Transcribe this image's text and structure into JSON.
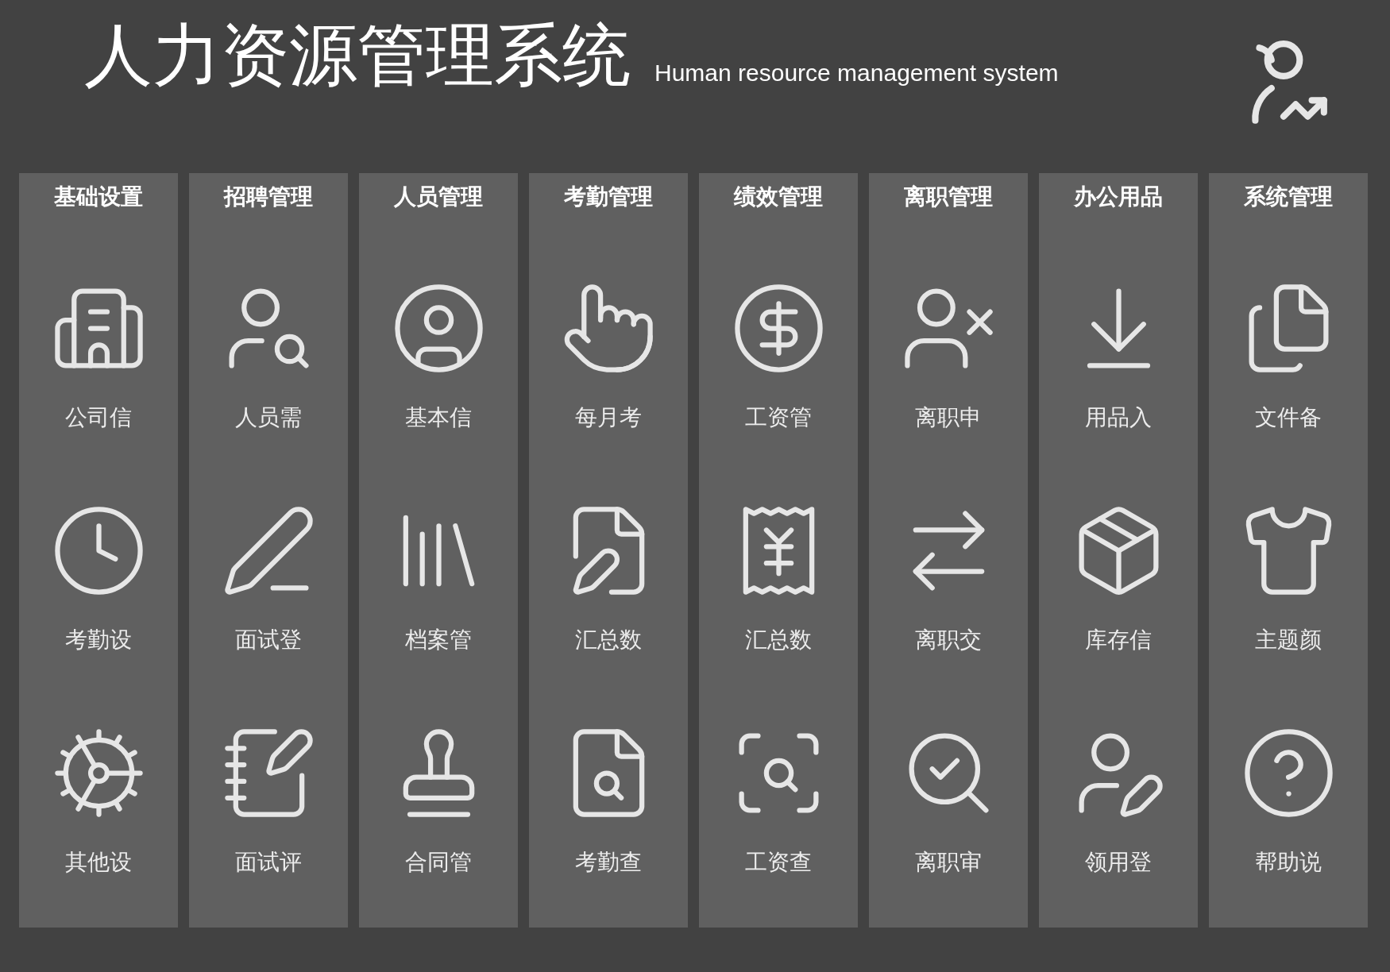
{
  "header": {
    "title": "人力资源管理系统",
    "subtitle": "Human resource management system"
  },
  "columns": [
    {
      "heading": "基础设置",
      "items": [
        {
          "label": "公司信"
        },
        {
          "label": "考勤设"
        },
        {
          "label": "其他设"
        }
      ]
    },
    {
      "heading": "招聘管理",
      "items": [
        {
          "label": "人员需"
        },
        {
          "label": "面试登"
        },
        {
          "label": "面试评"
        }
      ]
    },
    {
      "heading": "人员管理",
      "items": [
        {
          "label": "基本信"
        },
        {
          "label": "档案管"
        },
        {
          "label": "合同管"
        }
      ]
    },
    {
      "heading": "考勤管理",
      "items": [
        {
          "label": "每月考"
        },
        {
          "label": "汇总数"
        },
        {
          "label": "考勤查"
        }
      ]
    },
    {
      "heading": "绩效管理",
      "items": [
        {
          "label": "工资管"
        },
        {
          "label": "汇总数"
        },
        {
          "label": "工资查"
        }
      ]
    },
    {
      "heading": "离职管理",
      "items": [
        {
          "label": "离职申"
        },
        {
          "label": "离职交"
        },
        {
          "label": "离职审"
        }
      ]
    },
    {
      "heading": "办公用品",
      "items": [
        {
          "label": "用品入"
        },
        {
          "label": "库存信"
        },
        {
          "label": "领用登"
        }
      ]
    },
    {
      "heading": "系统管理",
      "items": [
        {
          "label": "文件备"
        },
        {
          "label": "主题颜"
        },
        {
          "label": "帮助说"
        }
      ]
    }
  ]
}
